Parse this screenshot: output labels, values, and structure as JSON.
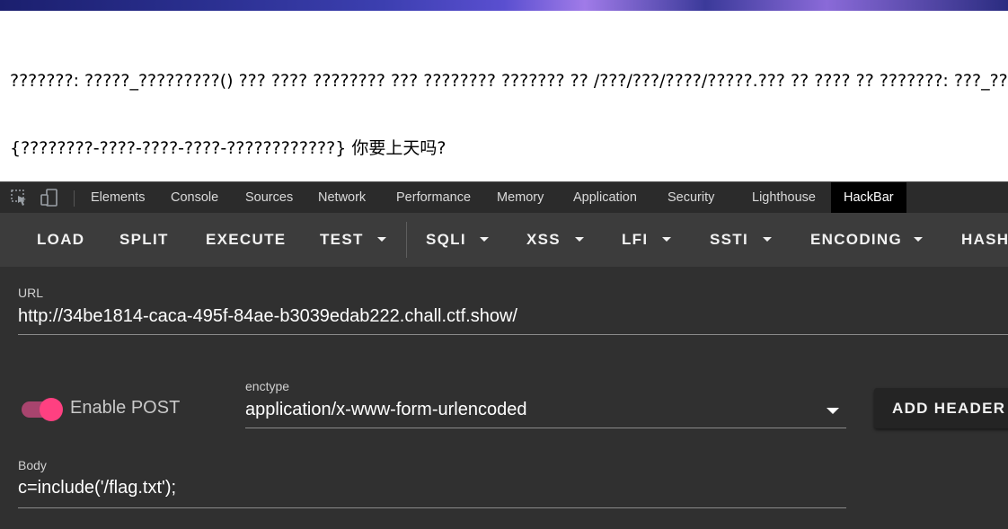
{
  "page": {
    "line1": "???????: ?????_?????????() ??? ???? ???????? ??? ???????? ??????? ?? /???/???/????/?????.??? ?? ???? ?? ???????: ???_???() ??",
    "line2": "{????????-????-????-????-????????????} 你要上天吗?"
  },
  "devtools": {
    "tabs": [
      "Elements",
      "Console",
      "Sources",
      "Network",
      "Performance",
      "Memory",
      "Application",
      "Security",
      "Lighthouse",
      "HackBar"
    ],
    "active_tab": "HackBar"
  },
  "hackbar": {
    "toolbar": {
      "load": "LOAD",
      "split": "SPLIT",
      "execute": "EXECUTE",
      "test": "TEST",
      "sqli": "SQLI",
      "xss": "XSS",
      "lfi": "LFI",
      "ssti": "SSTI",
      "encoding": "ENCODING",
      "hash": "HASH"
    },
    "url_label": "URL",
    "url_value": "http://34be1814-caca-495f-84ae-b3039edab222.chall.ctf.show/",
    "enable_post_label": "Enable POST",
    "enable_post_on": true,
    "enctype_label": "enctype",
    "enctype_value": "application/x-www-form-urlencoded",
    "add_header_label": "ADD HEADER",
    "body_label": "Body",
    "body_value": "c=include('/flag.txt');"
  },
  "colors": {
    "toggle_accent": "#ff4081",
    "toolbar_bg": "#3c3c3c",
    "panel_bg": "#303030"
  }
}
